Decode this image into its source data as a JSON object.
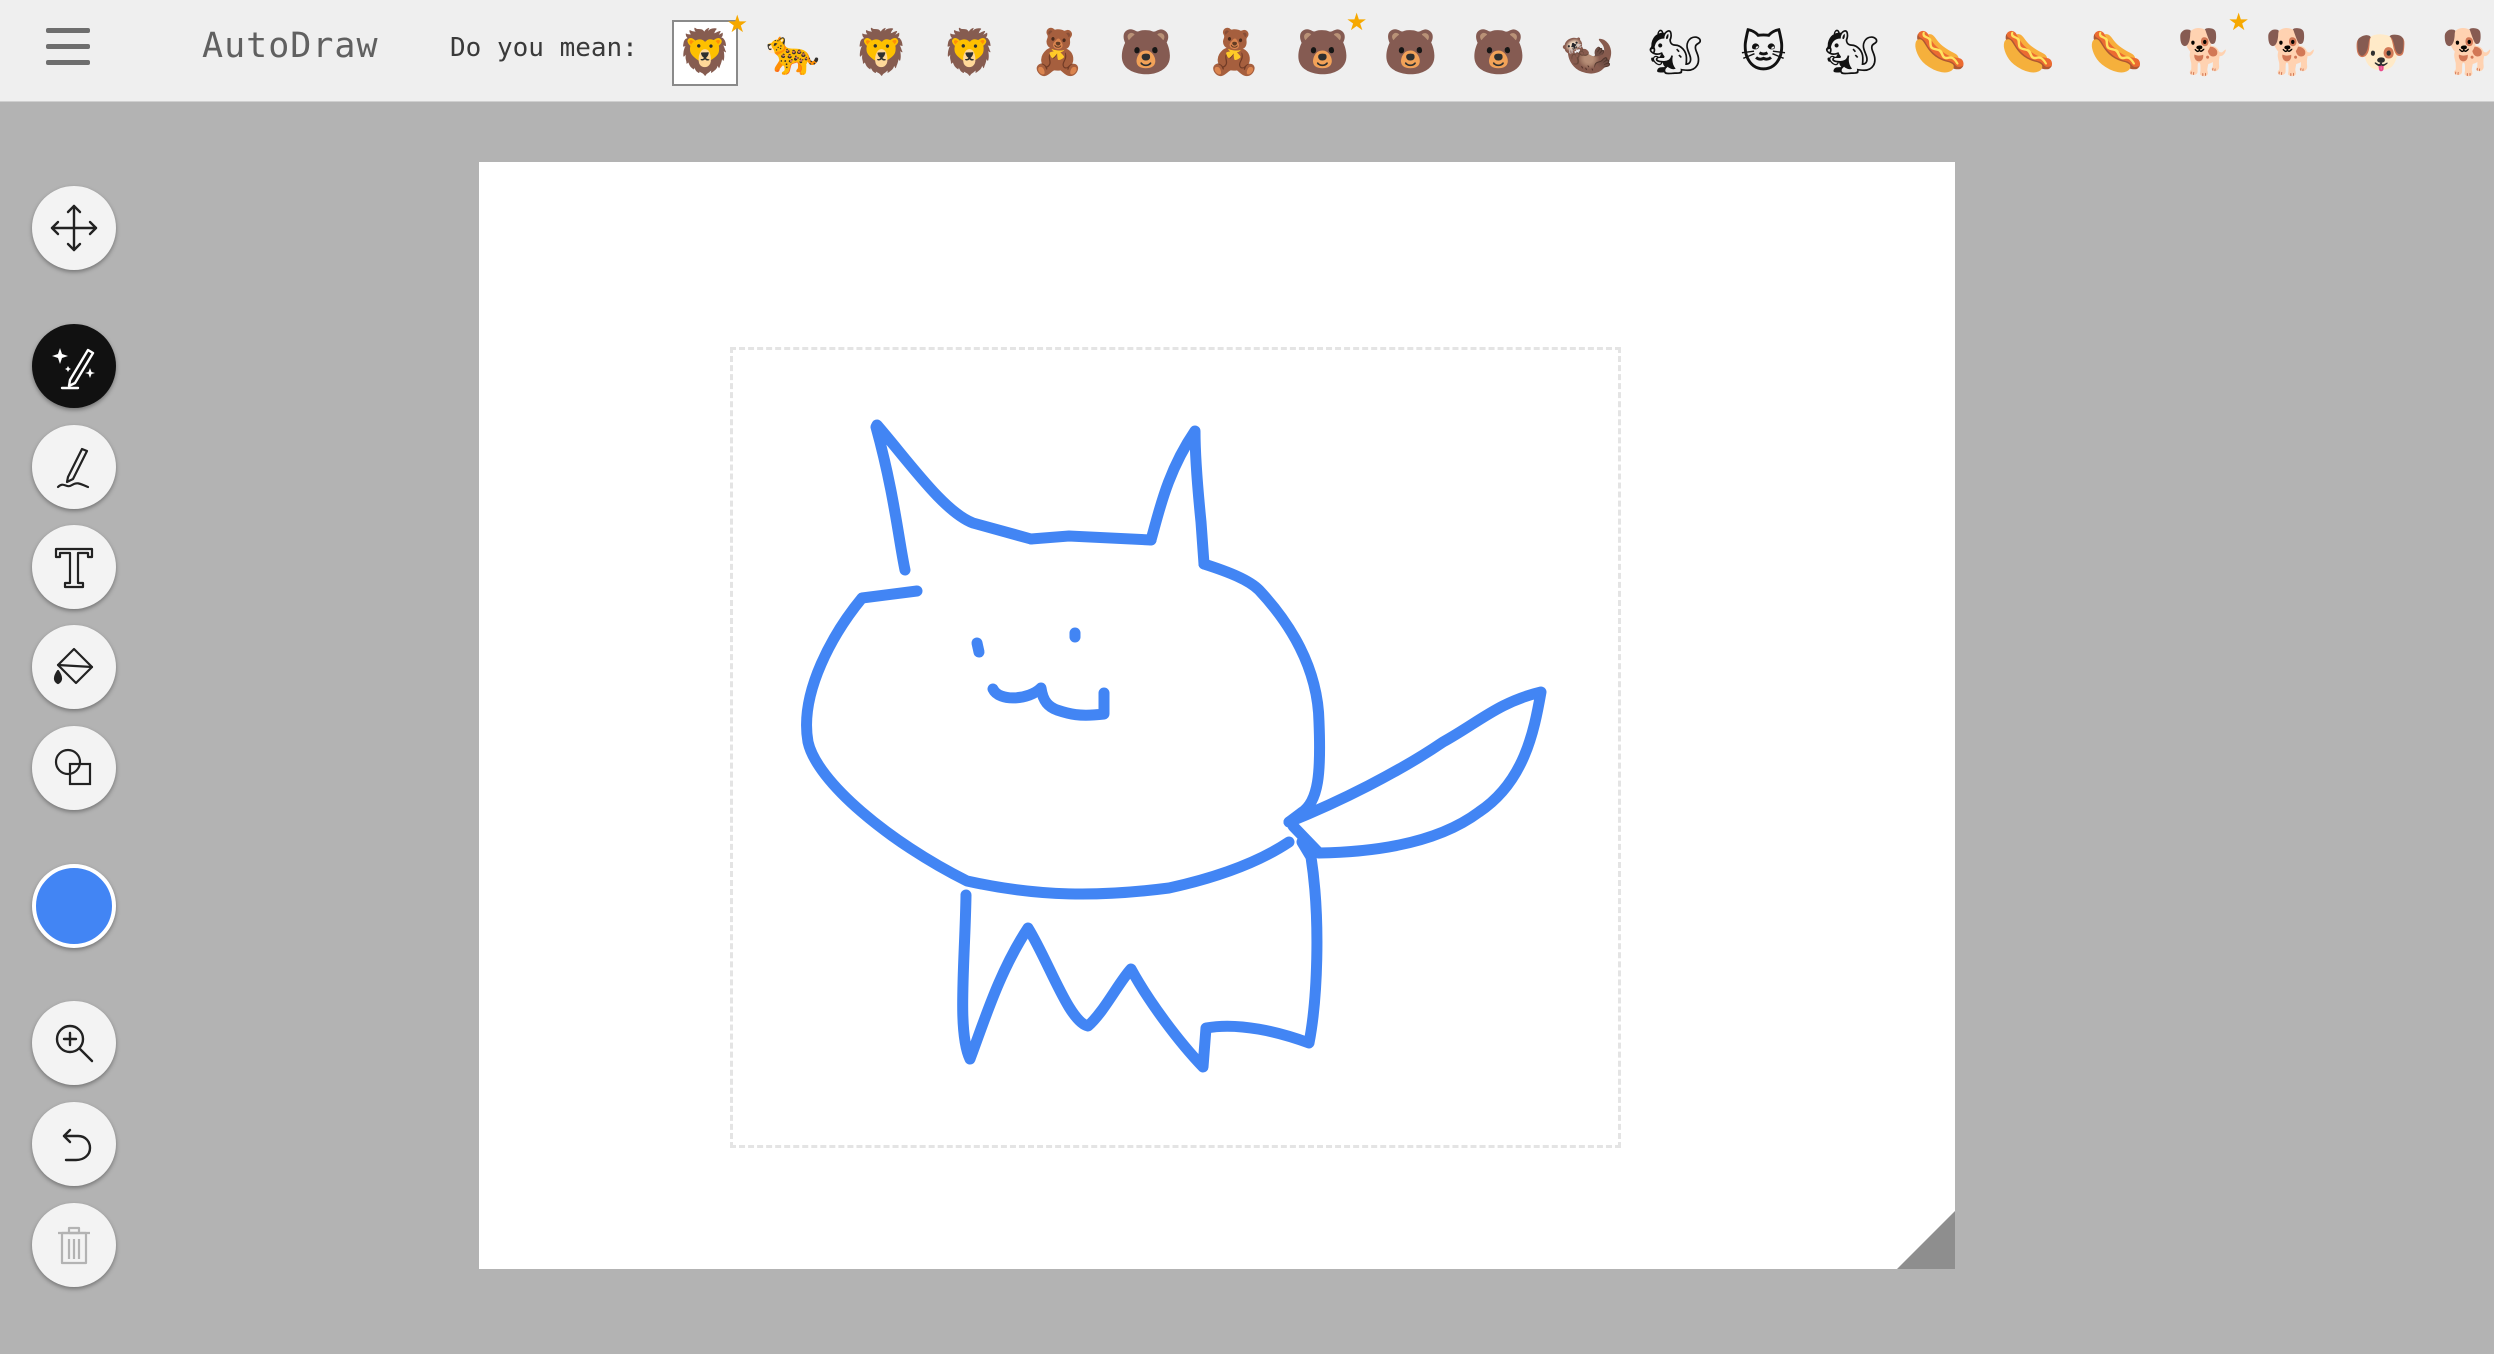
{
  "header": {
    "app_title": "AutoDraw",
    "suggest_label": "Do you mean:",
    "suggestions": [
      {
        "icon": "lion-icon",
        "glyph": "🦁",
        "starred": "★",
        "selected": true
      },
      {
        "icon": "lion-walking-icon",
        "glyph": "🐆",
        "starred": ""
      },
      {
        "icon": "lion-face-icon",
        "glyph": "🦁",
        "starred": ""
      },
      {
        "icon": "lion-head-side-icon",
        "glyph": "🦁",
        "starred": ""
      },
      {
        "icon": "teddy-figure-icon",
        "glyph": "🧸",
        "starred": ""
      },
      {
        "icon": "bear-face-bow-icon",
        "glyph": "🐻",
        "starred": ""
      },
      {
        "icon": "teddy-bear-icon",
        "glyph": "🧸",
        "starred": ""
      },
      {
        "icon": "bear-small-face-icon",
        "glyph": "🐻",
        "starred": "★"
      },
      {
        "icon": "bear-walking-icon",
        "glyph": "🐻",
        "starred": ""
      },
      {
        "icon": "bear-head-icon",
        "glyph": "🐻",
        "starred": ""
      },
      {
        "icon": "meerkat-icon",
        "glyph": "🦦",
        "starred": ""
      },
      {
        "icon": "squirrel-icon",
        "glyph": "🐿",
        "starred": ""
      },
      {
        "icon": "cat-face-icon",
        "glyph": "🐱",
        "starred": ""
      },
      {
        "icon": "squirrel-tail-icon",
        "glyph": "🐿",
        "starred": ""
      },
      {
        "icon": "hotdog-icon",
        "glyph": "🌭",
        "starred": ""
      },
      {
        "icon": "hotdog-bun-icon",
        "glyph": "🌭",
        "starred": ""
      },
      {
        "icon": "hotdog-side-icon",
        "glyph": "🌭",
        "starred": ""
      },
      {
        "icon": "dachshund-icon",
        "glyph": "🐕",
        "starred": "★"
      },
      {
        "icon": "dog-standing-icon",
        "glyph": "🐕",
        "starred": ""
      },
      {
        "icon": "dog-face-icon",
        "glyph": "🐶",
        "starred": ""
      },
      {
        "icon": "dog-sitting-icon",
        "glyph": "🐕",
        "starred": ""
      }
    ]
  },
  "toolbar": {
    "tools": [
      {
        "name": "move-tool-button",
        "icon": "move-icon"
      },
      {
        "name": "autodraw-tool-button",
        "icon": "magic-pencil-icon",
        "active": true
      },
      {
        "name": "draw-tool-button",
        "icon": "pencil-icon"
      },
      {
        "name": "text-tool-button",
        "icon": "text-icon"
      },
      {
        "name": "fill-tool-button",
        "icon": "paint-bucket-icon"
      },
      {
        "name": "shape-tool-button",
        "icon": "shapes-icon"
      },
      {
        "name": "zoom-button",
        "icon": "zoom-in-icon"
      },
      {
        "name": "undo-button",
        "icon": "undo-icon"
      },
      {
        "name": "delete-button",
        "icon": "trash-icon",
        "disabled": true
      }
    ],
    "current_color": "#4285f4"
  },
  "colors": {
    "stroke": "#4285f4",
    "star": "#f6a800",
    "background": "#b3b3b3"
  }
}
